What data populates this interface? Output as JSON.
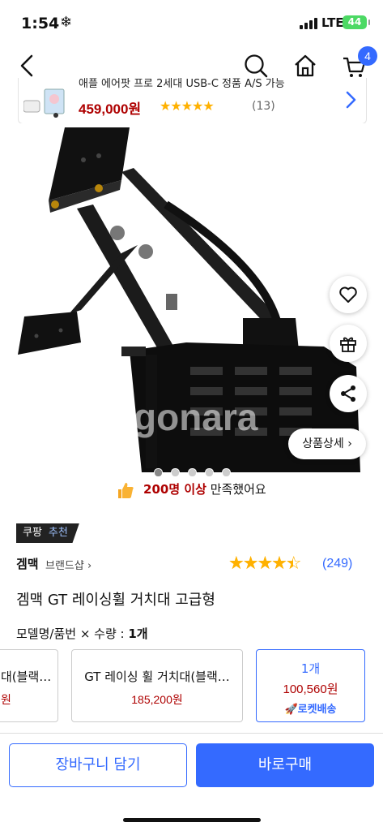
{
  "status": {
    "time": "1:54",
    "time_icon": "snowflake-icon",
    "network": "LTE",
    "battery": "44"
  },
  "nav": {
    "cart_count": "4"
  },
  "mini_card": {
    "name": "애플 에어팟 프로 2세대 USB-C 정품 A/S 가능",
    "price": "459,000원",
    "rating_stars": "★★★★★",
    "review_count": "(13)"
  },
  "image": {
    "watermark": "gonara",
    "detail_button": "상품상세",
    "carousel": {
      "total": 5,
      "active": 1
    }
  },
  "satisfaction": {
    "count": "200명 이상",
    "suffix": " 만족했어요"
  },
  "badge": {
    "part1": "쿠팡",
    "part2": "추천"
  },
  "brand": {
    "name": "겜맥",
    "shop_label": "브랜드샵"
  },
  "rating": {
    "value": 4.5,
    "count": "(249)"
  },
  "product_title": "겜맥 GT 레이싱휠 거치대 고급형",
  "option": {
    "label": "모델명/품번 × 수량 : ",
    "quantity": "1개",
    "items": [
      {
        "name": "대(블랙…",
        "price": "원"
      },
      {
        "name": "GT 레이싱 휠 거치대(블랙…",
        "price": "185,200원"
      },
      {
        "name": "1개",
        "price": "100,560원",
        "tag": "로켓배송",
        "selected": true
      }
    ]
  },
  "actions": {
    "cart": "장바구니 담기",
    "buy": "바로구매"
  },
  "colors": {
    "accent": "#346aff",
    "price": "#ae0000",
    "star": "#ffb100"
  }
}
